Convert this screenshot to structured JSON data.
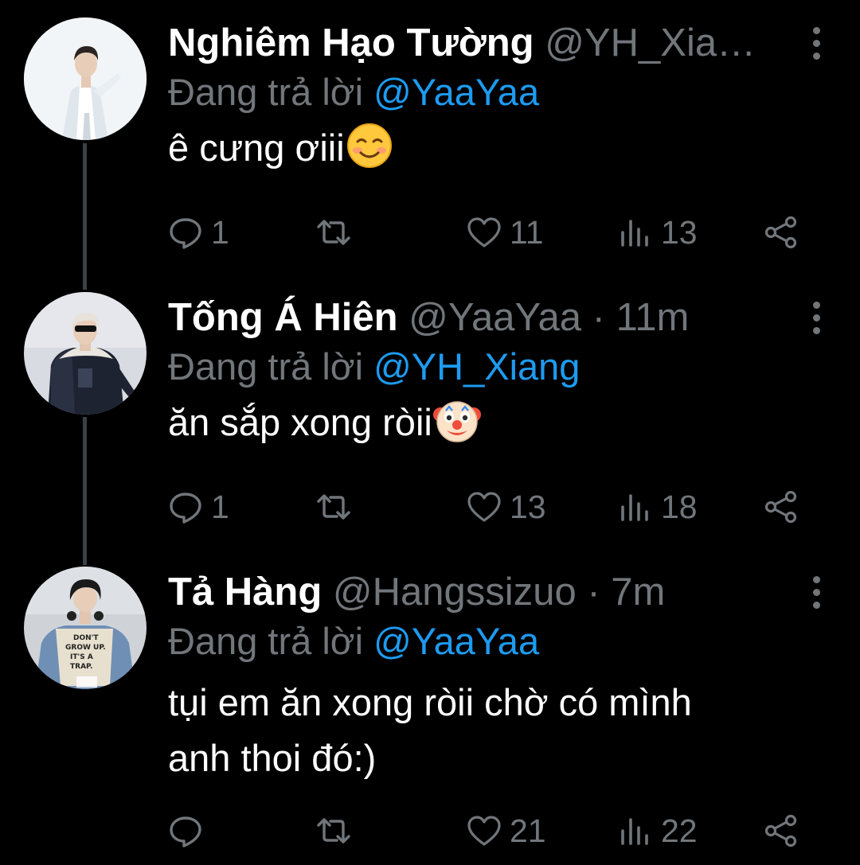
{
  "colors": {
    "background": "#000000",
    "text_primary": "#ffffff",
    "text_secondary": "#71767b",
    "mention": "#1d9bf0",
    "thread_line": "#3a4047"
  },
  "tweets": [
    {
      "author_name": "Nghiêm Hạo Tường",
      "handle": "@YH_Xia…",
      "separator": "",
      "time": "",
      "reply_prefix": "Đang trả lời",
      "reply_to": "@YaaYaa",
      "text": "ê cưng ơiii",
      "emoji_icon": "smiling-face-icon",
      "replies": "1",
      "retweets": "",
      "likes": "11",
      "views": "13"
    },
    {
      "author_name": "Tống Á Hiên",
      "handle": "@YaaYaa",
      "separator": "·",
      "time": "11m",
      "reply_prefix": "Đang trả lời",
      "reply_to": "@YH_Xiang",
      "text": "ăn sắp xong ròii",
      "emoji_icon": "clown-face-icon",
      "replies": "1",
      "retweets": "",
      "likes": "13",
      "views": "18"
    },
    {
      "author_name": "Tả Hàng",
      "handle": "@Hangssizuo",
      "separator": "·",
      "time": "7m",
      "reply_prefix": "Đang trả lời",
      "reply_to": "@YaaYaa",
      "text_line1": "tụi em ăn xong ròii chờ có mình",
      "text_line2": "anh thoi đó:)",
      "replies": "",
      "retweets": "",
      "likes": "21",
      "views": "22",
      "avatar_shirt_text": [
        "DON'T",
        "GROW UP.",
        "IT'S A",
        "TRAP."
      ]
    }
  ]
}
